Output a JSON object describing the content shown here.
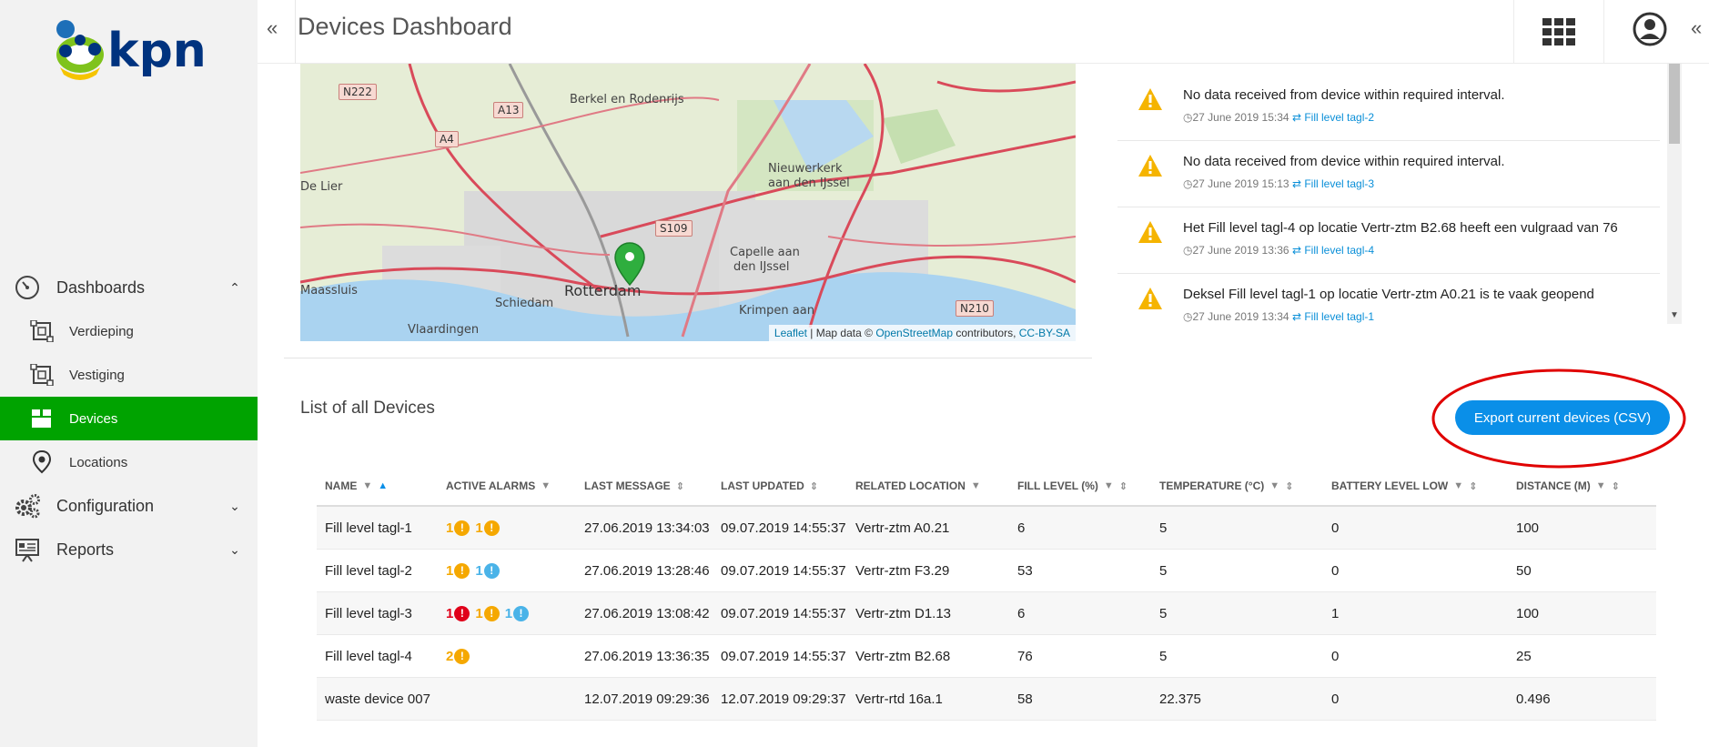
{
  "brand": {
    "name": "kpn",
    "color": "#00337f",
    "accent": "#00a300"
  },
  "header": {
    "title": "Devices Dashboard",
    "collapse_left": "«",
    "collapse_right": "«"
  },
  "sidebar": {
    "groups": [
      {
        "label": "Dashboards",
        "icon": "speedometer-icon",
        "expanded": true,
        "items": [
          {
            "label": "Verdieping",
            "icon": "floor-plan-icon"
          },
          {
            "label": "Vestiging",
            "icon": "floor-plan-icon"
          },
          {
            "label": "Devices",
            "icon": "devices-icon",
            "active": true
          },
          {
            "label": "Locations",
            "icon": "map-pin-icon"
          }
        ]
      },
      {
        "label": "Configuration",
        "icon": "gears-icon",
        "expanded": false
      },
      {
        "label": "Reports",
        "icon": "presentation-icon",
        "expanded": false
      }
    ]
  },
  "map": {
    "labels": {
      "berkel": "Berkel en Rodenrijs",
      "delier": "De Lier",
      "nieuwerkerk1": "Nieuwerkerk",
      "nieuwerkerk2": "aan den IJssel",
      "capelle1": "Capelle aan",
      "capelle2": "den IJssel",
      "maassluis": "Maassluis",
      "schiedam": "Schiedam",
      "rotterdam": "Rotterdam",
      "vlaardingen": "Vlaardingen",
      "krimpen": "Krimpen aan"
    },
    "shields": {
      "n222": "N222",
      "a13": "A13",
      "a4": "A4",
      "s109": "S109",
      "n210": "N210"
    },
    "attribution": {
      "leaflet": "Leaflet",
      "sep": "| Map data ©",
      "osm": "OpenStreetMap",
      "contrib": "contributors,",
      "license": "CC-BY-SA"
    }
  },
  "alerts": [
    {
      "message": "No data received from device within required interval.",
      "time": "27 June 2019 15:34",
      "device": "Fill level tagl-2"
    },
    {
      "message": "No data received from device within required interval.",
      "time": "27 June 2019 15:13",
      "device": "Fill level tagl-3"
    },
    {
      "message": "Het Fill level tagl-4 op locatie Vertr-ztm B2.68 heeft een vulgraad van 76",
      "time": "27 June 2019 13:36",
      "device": "Fill level tagl-4"
    },
    {
      "message": "Deksel Fill level tagl-1 op locatie Vertr-ztm A0.21 is te vaak geopend",
      "time": "27 June 2019 13:34",
      "device": "Fill level tagl-1"
    }
  ],
  "devices": {
    "title": "List of all Devices",
    "export_label": "Export current devices (CSV)",
    "columns": [
      "NAME",
      "ACTIVE ALARMS",
      "LAST MESSAGE",
      "LAST UPDATED",
      "RELATED LOCATION",
      "FILL LEVEL (%)",
      "TEMPERATURE (°C)",
      "BATTERY LEVEL LOW",
      "DISTANCE (M)"
    ],
    "rows": [
      {
        "name": "Fill level tagl-1",
        "alarms": [
          {
            "count": "1",
            "level": "orange"
          },
          {
            "count": "1",
            "level": "orange"
          }
        ],
        "last_message": "27.06.2019 13:34:03",
        "last_updated": "09.07.2019 14:55:37",
        "location": "Vertr-ztm A0.21",
        "fill": "6",
        "temp": "5",
        "battery": "0",
        "distance": "100"
      },
      {
        "name": "Fill level tagl-2",
        "alarms": [
          {
            "count": "1",
            "level": "orange"
          },
          {
            "count": "1",
            "level": "blue"
          }
        ],
        "last_message": "27.06.2019 13:28:46",
        "last_updated": "09.07.2019 14:55:37",
        "location": "Vertr-ztm F3.29",
        "fill": "53",
        "temp": "5",
        "battery": "0",
        "distance": "50"
      },
      {
        "name": "Fill level tagl-3",
        "alarms": [
          {
            "count": "1",
            "level": "red"
          },
          {
            "count": "1",
            "level": "orange"
          },
          {
            "count": "1",
            "level": "blue"
          }
        ],
        "last_message": "27.06.2019 13:08:42",
        "last_updated": "09.07.2019 14:55:37",
        "location": "Vertr-ztm D1.13",
        "fill": "6",
        "temp": "5",
        "battery": "1",
        "distance": "100"
      },
      {
        "name": "Fill level tagl-4",
        "alarms": [
          {
            "count": "2",
            "level": "orange"
          }
        ],
        "last_message": "27.06.2019 13:36:35",
        "last_updated": "09.07.2019 14:55:37",
        "location": "Vertr-ztm B2.68",
        "fill": "76",
        "temp": "5",
        "battery": "0",
        "distance": "25"
      },
      {
        "name": "waste device 007",
        "alarms": [],
        "last_message": "12.07.2019 09:29:36",
        "last_updated": "12.07.2019 09:29:37",
        "location": "Vertr-rtd 16a.1",
        "fill": "58",
        "temp": "22.375",
        "battery": "0",
        "distance": "0.496"
      }
    ]
  }
}
